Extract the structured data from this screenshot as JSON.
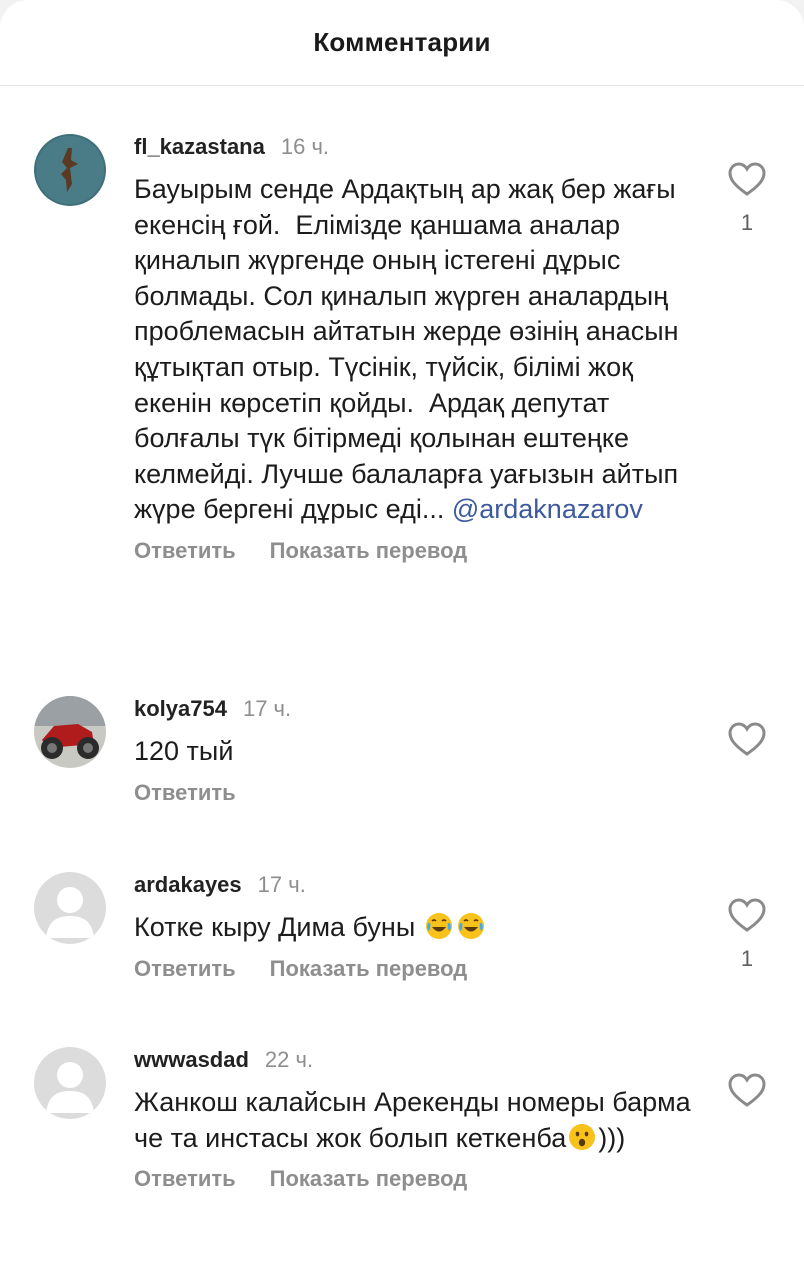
{
  "header": {
    "title": "Комментарии"
  },
  "comments": [
    {
      "username": "fl_kazastana",
      "time": "16 ч.",
      "text": "Бауырым сенде Ардақтың ар жақ бер жағы екенсің ғой.  Елімізде қаншама аналар қиналып жүргенде оның істегені дұрыс болмады. Сол қиналып жүрген аналардың проблемасын айтатын жерде өзінің анасын құтықтап отыр. Түсінік, түйсік, білімі жоқ екенін көрсетіп қойды.  Ардақ депутат болғалы түк бітірмеді қолынан ештеңке келмейді. Лучше балаларға уағызын айтып жүре бергені дұрыс еді...",
      "mention": "@ardaknazarov",
      "reply_label": "Ответить",
      "translate_label": "Показать перевод",
      "like_count": "1"
    },
    {
      "username": "kolya754",
      "time": "17 ч.",
      "text": "120 тый",
      "reply_label": "Ответить"
    },
    {
      "username": "ardakayes",
      "time": "17 ч.",
      "text": "Котке кыру Дима буны",
      "reply_label": "Ответить",
      "translate_label": "Показать перевод",
      "like_count": "1"
    },
    {
      "username": "wwwasdad",
      "time": "22 ч.",
      "text_line1": "Жанкош калайсын Арекенды номеры барма че та инстасы жок болып кеткенба",
      "text_tail": ")))",
      "reply_label": "Ответить",
      "translate_label": "Показать перевод"
    }
  ],
  "icons": {
    "like": "heart-outline-icon",
    "emoji_joy": "tears-of-joy-emoji",
    "emoji_wow": "astonished-emoji"
  }
}
